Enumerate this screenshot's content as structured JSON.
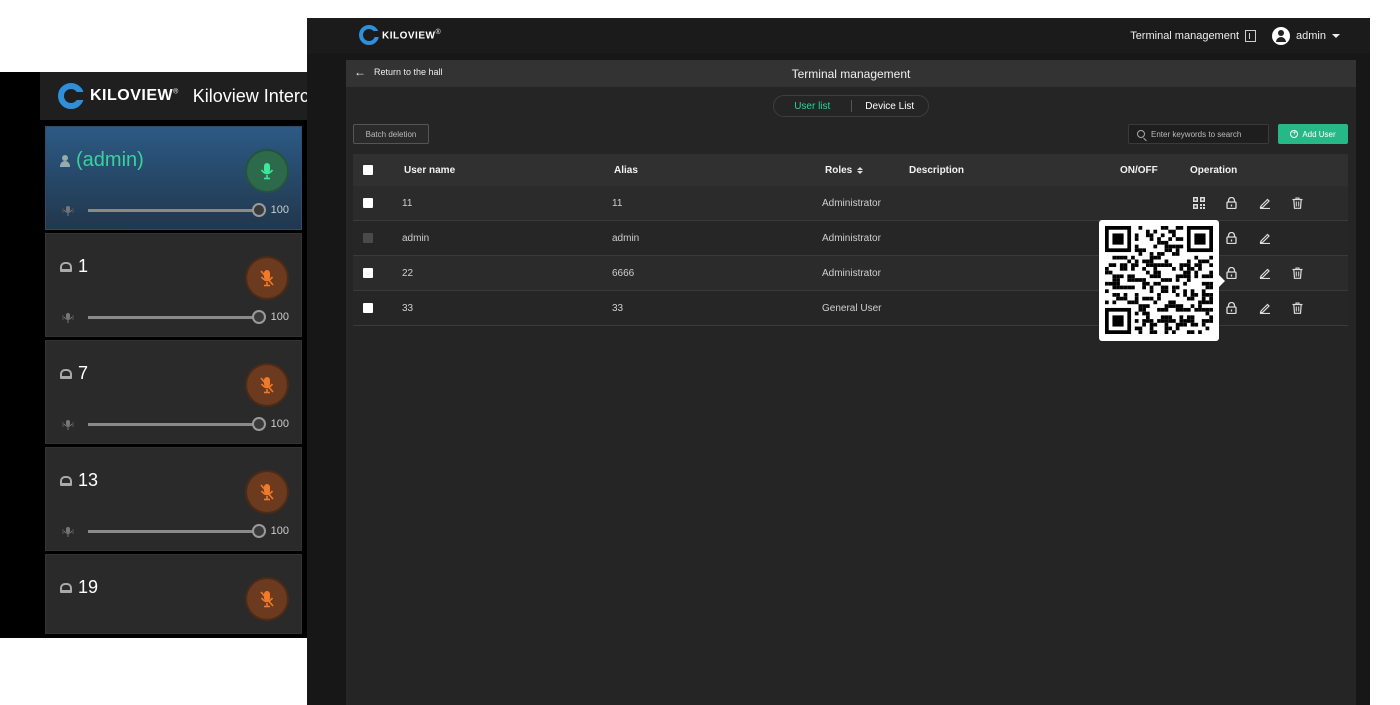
{
  "intercom": {
    "brand": "KILOVIEW",
    "brand_mark": "®",
    "title": "Kiloview Intercom",
    "cards": [
      {
        "name": "(admin)",
        "volume": "100",
        "mic": "on",
        "active": true,
        "icon": "person-icon"
      },
      {
        "name": "1",
        "volume": "100",
        "mic": "muted",
        "active": false,
        "icon": "terminal-icon"
      },
      {
        "name": "7",
        "volume": "100",
        "mic": "muted",
        "active": false,
        "icon": "terminal-icon"
      },
      {
        "name": "13",
        "volume": "100",
        "mic": "muted",
        "active": false,
        "icon": "terminal-icon"
      },
      {
        "name": "19",
        "volume": null,
        "mic": "muted",
        "active": false,
        "icon": "terminal-icon"
      }
    ]
  },
  "management": {
    "brand": "KILOVIEW",
    "brand_mark": "®",
    "topbar": {
      "terminal_label": "Terminal management",
      "user": "admin"
    },
    "back_label": "Return to the hall",
    "page_title": "Terminal management",
    "tabs": [
      {
        "label": "User list",
        "active": true
      },
      {
        "label": "Device List",
        "active": false
      }
    ],
    "batch_delete_label": "Batch deletion",
    "search": {
      "placeholder": "Enter keywords to search",
      "value": ""
    },
    "add_user_label": "Add User",
    "table": {
      "headers": {
        "user_name": "User name",
        "alias": "Alias",
        "roles": "Roles",
        "description": "Description",
        "on_off": "ON/OFF",
        "operation": "Operation"
      },
      "rows": [
        {
          "user_name": "11",
          "alias": "11",
          "role": "Administrator",
          "description": "",
          "toggle": null,
          "can_delete": true,
          "checkbox_enabled": true
        },
        {
          "user_name": "admin",
          "alias": "admin",
          "role": "Administrator",
          "description": "",
          "toggle": null,
          "can_delete": false,
          "checkbox_enabled": false
        },
        {
          "user_name": "22",
          "alias": "6666",
          "role": "Administrator",
          "description": "",
          "toggle": null,
          "can_delete": true,
          "checkbox_enabled": true
        },
        {
          "user_name": "33",
          "alias": "33",
          "role": "General User",
          "description": "",
          "toggle": "ON",
          "can_delete": true,
          "checkbox_enabled": true
        }
      ]
    },
    "qr_popup": {
      "visible": true,
      "row": 1
    }
  },
  "colors": {
    "accent_green": "#2fd39b",
    "add_button": "#27b887",
    "brand_blue": "#2f8fd9",
    "toggle_blue": "#2f8fe3",
    "mic_on": "#2d6a4c",
    "mic_muted": "#6b3a1f"
  }
}
